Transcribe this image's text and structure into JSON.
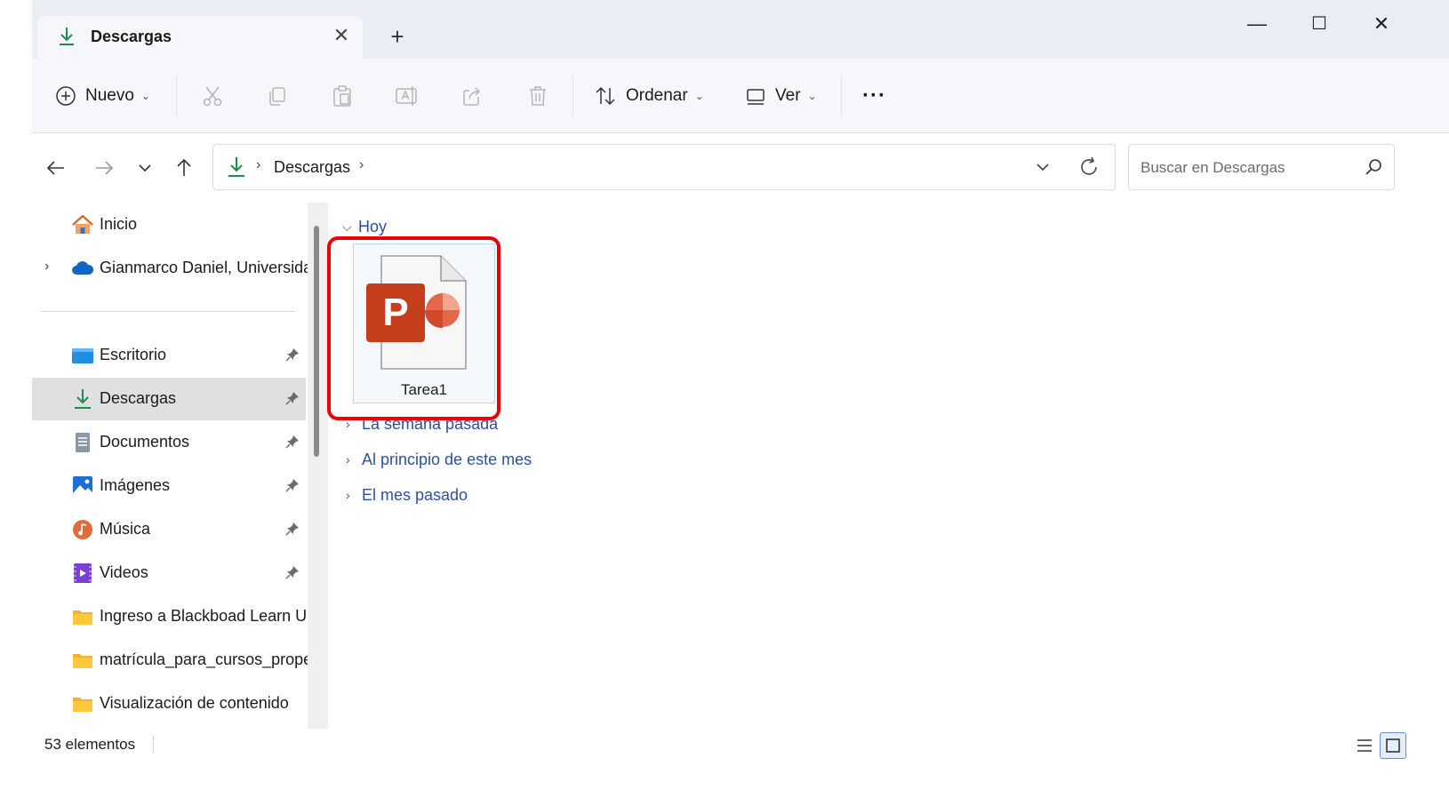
{
  "tab": {
    "title": "Descargas",
    "close": "✕",
    "new_tab": "+"
  },
  "window_controls": {
    "minimize": "—",
    "maximize": "☐",
    "close": "✕"
  },
  "toolbar": {
    "new_label": "Nuevo",
    "sort_label": "Ordenar",
    "view_label": "Ver",
    "more_label": "···"
  },
  "address": {
    "crumb": "Descargas",
    "sep": "›"
  },
  "search": {
    "placeholder": "Buscar en Descargas"
  },
  "sidebar": {
    "items": [
      {
        "label": "Inicio"
      },
      {
        "label": "Gianmarco Daniel, Universidad"
      },
      {
        "label": "Escritorio"
      },
      {
        "label": "Descargas"
      },
      {
        "label": "Documentos"
      },
      {
        "label": "Imágenes"
      },
      {
        "label": "Música"
      },
      {
        "label": "Videos"
      },
      {
        "label": "Ingreso a Blackboad Learn U"
      },
      {
        "label": "matrícula_para_cursos_prope"
      },
      {
        "label": "Visualización de contenido"
      }
    ]
  },
  "content": {
    "groups": [
      {
        "label": "Hoy"
      },
      {
        "label": "La semana pasada"
      },
      {
        "label": "Al principio de este mes"
      },
      {
        "label": "El mes pasado"
      }
    ],
    "file": {
      "name": "Tarea1"
    }
  },
  "status": {
    "count": "53 elementos"
  },
  "colors": {
    "accent": "#2d4f9e",
    "highlight": "#ee0000",
    "powerpoint": "#c43e1c",
    "download_green": "#1e8c4e"
  }
}
